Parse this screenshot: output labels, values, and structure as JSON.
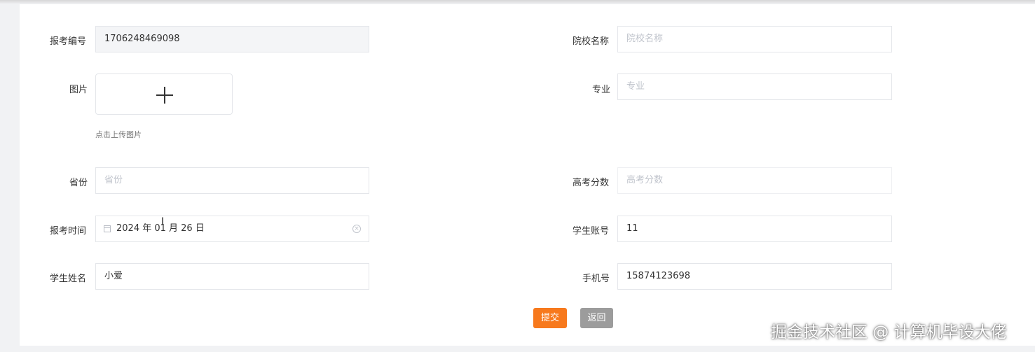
{
  "form": {
    "exam_number": {
      "label": "报考编号",
      "value": "1706248469098"
    },
    "image": {
      "label": "图片",
      "upload_hint": "点击上传图片"
    },
    "province": {
      "label": "省份",
      "placeholder": "省份"
    },
    "exam_time": {
      "label": "报考时间",
      "value": "2024 年 01 月 26 日"
    },
    "student_name": {
      "label": "学生姓名",
      "value": "小爱"
    },
    "school_name": {
      "label": "院校名称",
      "placeholder": "院校名称"
    },
    "major": {
      "label": "专业",
      "placeholder": "专业"
    },
    "gaokao_score": {
      "label": "高考分数",
      "placeholder": "高考分数"
    },
    "student_account": {
      "label": "学生账号",
      "value": "11"
    },
    "phone": {
      "label": "手机号",
      "value": "15874123698"
    }
  },
  "buttons": {
    "submit_label": "提交",
    "back_label": "返回"
  },
  "watermark": {
    "text": "掘金技术社区 @ 计算机毕设大佬"
  },
  "icons": {
    "upload": "plus-icon",
    "date": "calendar-icon",
    "clear": "clear-circle-icon",
    "cursor": "text-cursor-icon"
  },
  "colors": {
    "submit": "#f7791d",
    "back": "#9c9c9c",
    "readonly_bg": "#f4f5f7",
    "placeholder": "#c0c4cc"
  }
}
